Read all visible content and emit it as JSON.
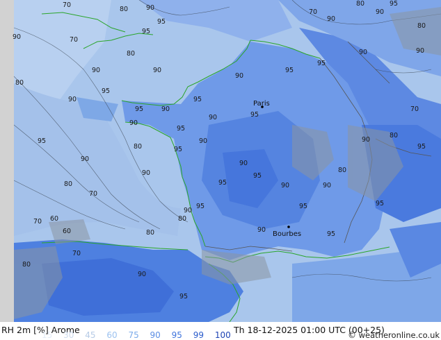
{
  "map": {
    "cities": [
      "Paris",
      "Bourbes"
    ],
    "contour_labels": [
      "70",
      "80",
      "90",
      "95",
      "90",
      "95",
      "70",
      "80",
      "90",
      "95",
      "90",
      "80",
      "90",
      "95",
      "90",
      "95",
      "90",
      "95",
      "80",
      "90",
      "95",
      "90",
      "95",
      "90",
      "80",
      "95",
      "90",
      "95",
      "90",
      "95",
      "90",
      "80",
      "95",
      "70",
      "60",
      "70",
      "80",
      "90",
      "95",
      "90",
      "70",
      "80",
      "90",
      "95",
      "80",
      "90",
      "95",
      "90",
      "70",
      "80",
      "90",
      "95",
      "90",
      "95",
      "80",
      "90",
      "95",
      "90",
      "95",
      "60",
      "70",
      "80",
      "90",
      "95"
    ]
  },
  "footer": {
    "title": "RH 2m [%] Arome",
    "legend": [
      {
        "label": "15",
        "color": "#e4ecf6"
      },
      {
        "label": "30",
        "color": "#cfdcee"
      },
      {
        "label": "45",
        "color": "#b6cbe6"
      },
      {
        "label": "60",
        "color": "#9cc2f0"
      },
      {
        "label": "75",
        "color": "#7aaaea"
      },
      {
        "label": "90",
        "color": "#5b8ee4"
      },
      {
        "label": "95",
        "color": "#3f74dc"
      },
      {
        "label": "99",
        "color": "#2a5ccc"
      },
      {
        "label": "100",
        "color": "#1e44b4"
      }
    ],
    "datetime": "Th 18-12-2025 01:00 UTC (00+25)",
    "credit": "weatheronline.co.uk",
    "copyright_symbol": "©"
  }
}
